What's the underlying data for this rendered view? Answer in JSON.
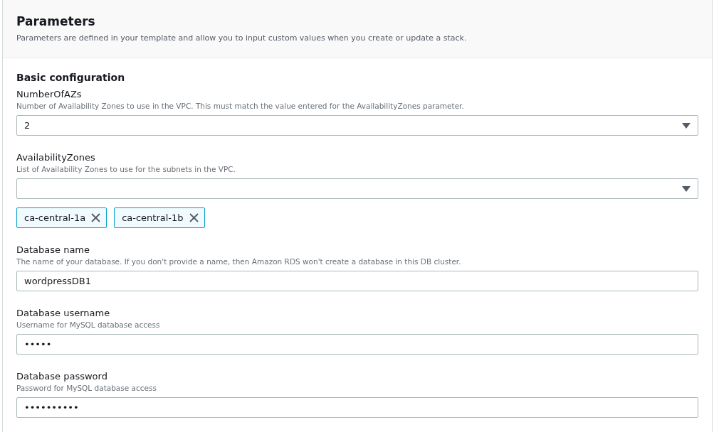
{
  "header": {
    "title": "Parameters",
    "description": "Parameters are defined in your template and allow you to input custom values when you create or update a stack."
  },
  "section": {
    "title": "Basic configuration"
  },
  "fields": [
    {
      "kind": "select",
      "label": "NumberOfAZs",
      "description": "Number of Availability Zones to use in the VPC. This must match the value entered for the AvailabilityZones parameter.",
      "value": "2"
    },
    {
      "kind": "multiselect",
      "label": "AvailabilityZones",
      "description": "List of Availability Zones to use for the subnets in the VPC.",
      "tokens": [
        "ca-central-1a",
        "ca-central-1b"
      ]
    },
    {
      "kind": "text",
      "label": "Database name",
      "description": "The name of your database. If you don't provide a name, then Amazon RDS won't create a database in this DB cluster.",
      "value": "wordpressDB1"
    },
    {
      "kind": "text",
      "label": "Database username",
      "description": "Username for MySQL database access",
      "value": "•••••"
    },
    {
      "kind": "text",
      "label": "Database password",
      "description": "Password for MySQL database access",
      "value": "••••••••••"
    }
  ]
}
